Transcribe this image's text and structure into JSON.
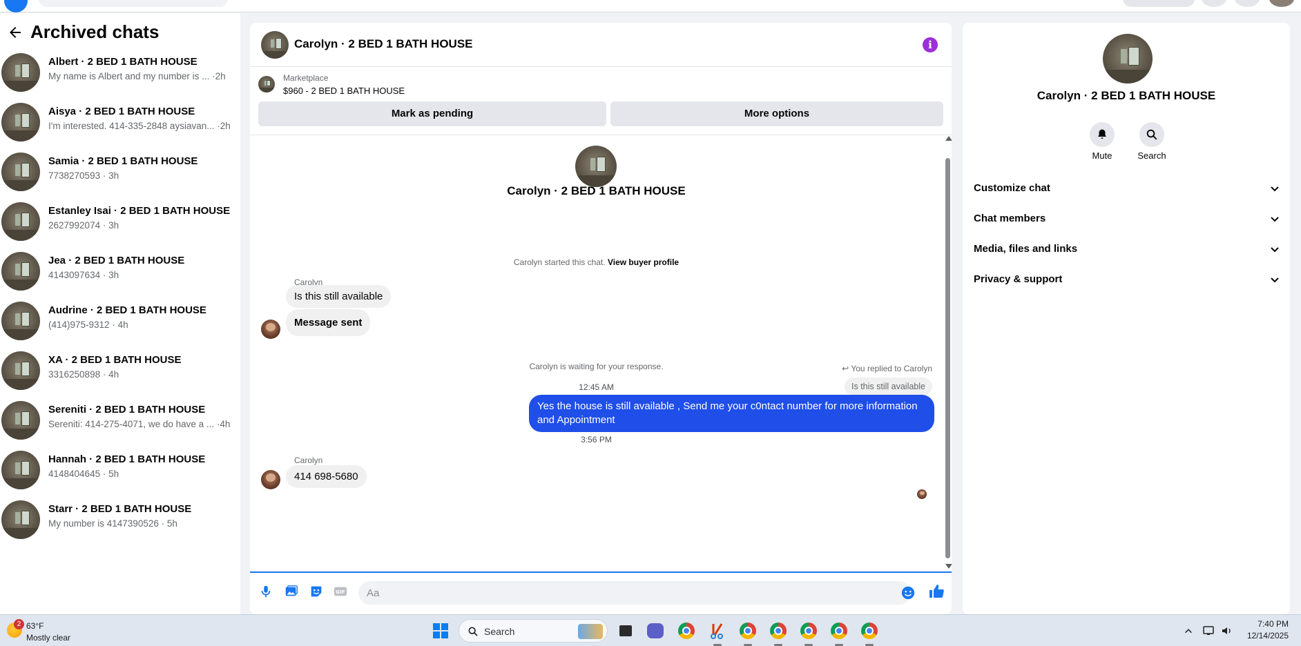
{
  "sidebar": {
    "title": "Archived chats",
    "chats": [
      {
        "name": "Albert · 2 BED 1 BATH HOUSE",
        "preview": "My name is Albert and my number is ... ·2h"
      },
      {
        "name": "Aisya · 2 BED 1 BATH HOUSE",
        "preview": "I'm interested. 414-335-2848 aysiavan... ·2h"
      },
      {
        "name": "Samia · 2 BED 1 BATH HOUSE",
        "preview": "7738270593 · 3h"
      },
      {
        "name": "Estanley Isai · 2 BED 1 BATH HOUSE",
        "preview": "2627992074 · 3h"
      },
      {
        "name": "Jea · 2 BED 1 BATH HOUSE",
        "preview": "4143097634 · 3h"
      },
      {
        "name": "Audrine · 2 BED 1 BATH HOUSE",
        "preview": "(414)975-9312 · 4h"
      },
      {
        "name": "XA · 2 BED 1 BATH HOUSE",
        "preview": "3316250898 · 4h"
      },
      {
        "name": "Sereniti · 2 BED 1 BATH HOUSE",
        "preview": "Sereniti: 414-275-4071, we do have a ... ·4h"
      },
      {
        "name": "Hannah · 2 BED 1 BATH HOUSE",
        "preview": "4148404645 · 5h"
      },
      {
        "name": "Starr · 2 BED 1 BATH HOUSE",
        "preview": "My number is 4147390526 · 5h"
      }
    ]
  },
  "chat": {
    "title": "Carolyn · 2 BED 1 BATH HOUSE",
    "marketplace_label": "Marketplace",
    "listing": "$960 - 2 BED 1 BATH HOUSE",
    "mark_pending": "Mark as pending",
    "more_options": "More options",
    "conversation_name": "Carolyn · 2 BED 1 BATH HOUSE",
    "started_text": "Carolyn started this chat.",
    "view_profile": "View buyer profile",
    "sender_1": "Carolyn",
    "msg_1": "Is this still available",
    "msg_2": "Message sent",
    "waiting_text": "Carolyn is waiting for your response.",
    "time_1": "12:45 AM",
    "replied_note": "You replied to Carolyn",
    "quoted": "Is this still available",
    "outgoing": "Yes the house is still available , Send me your c0ntact number for more information and Appointment",
    "time_2": "3:56 PM",
    "sender_2": "Carolyn",
    "msg_3": "414 698-5680",
    "input_placeholder": "Aa"
  },
  "info_panel": {
    "name": "Carolyn · 2 BED 1 BATH HOUSE",
    "mute_label": "Mute",
    "search_label": "Search",
    "sections": [
      "Customize chat",
      "Chat members",
      "Media, files and links",
      "Privacy & support"
    ]
  },
  "taskbar": {
    "weather_badge": "2",
    "temperature": "63°F",
    "weather": "Mostly clear",
    "search_label": "Search",
    "time": "7:40 PM",
    "date": "12/14/2025"
  },
  "colors": {
    "accent": "#1877f2",
    "outgoing_bubble": "#1f4ee8",
    "info_icon": "#9b30d9"
  }
}
